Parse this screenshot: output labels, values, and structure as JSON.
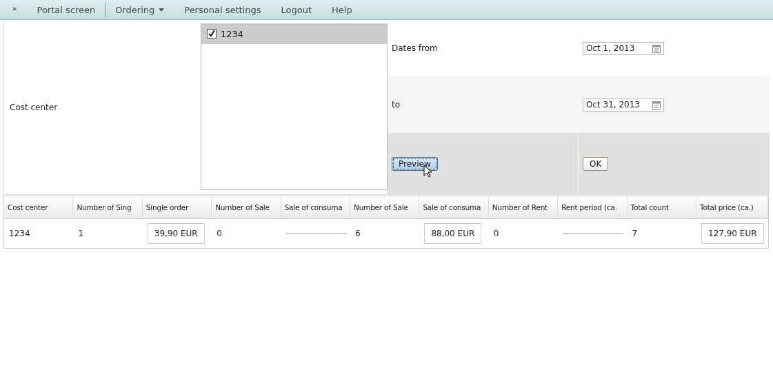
{
  "menu": [
    {
      "label": "*",
      "has_dropdown": false,
      "separator_after": false
    },
    {
      "label": "Portal screen",
      "has_dropdown": false,
      "separator_after": true
    },
    {
      "label": "Ordering",
      "has_dropdown": true,
      "separator_after": false
    },
    {
      "label": "Personal settings",
      "has_dropdown": false,
      "separator_after": false
    },
    {
      "label": "Logout",
      "has_dropdown": false,
      "separator_after": false
    },
    {
      "label": "Help",
      "has_dropdown": false,
      "separator_after": false
    }
  ],
  "filter": {
    "cost_center_label": "Cost center",
    "cost_centers": [
      {
        "label": "1234",
        "checked": true,
        "selected": true
      }
    ],
    "dates_from_label": "Dates from",
    "dates_from": "Oct 1, 2013",
    "to_label": "to",
    "to": "Oct 31, 2013",
    "preview_button": "Preview",
    "ok_button": "OK"
  },
  "table": {
    "columns": [
      "Cost center",
      "Number of Sing",
      "Single order",
      "Number of Sale",
      "Sale of consuma",
      "Number of Sale",
      "Sale of consuma",
      "Number of Rent",
      "Rent period (ca.",
      "Total count",
      "Total price (ca.)"
    ],
    "rows": [
      [
        {
          "kind": "text",
          "text": "1234"
        },
        {
          "kind": "text",
          "text": "1"
        },
        {
          "kind": "money",
          "text": "39,90 EUR"
        },
        {
          "kind": "text",
          "text": "0"
        },
        {
          "kind": "empty"
        },
        {
          "kind": "text",
          "text": "6"
        },
        {
          "kind": "money",
          "text": "88,00 EUR"
        },
        {
          "kind": "text",
          "text": "0"
        },
        {
          "kind": "empty"
        },
        {
          "kind": "text",
          "text": "7"
        },
        {
          "kind": "money",
          "text": "127,90 EUR"
        }
      ]
    ]
  }
}
